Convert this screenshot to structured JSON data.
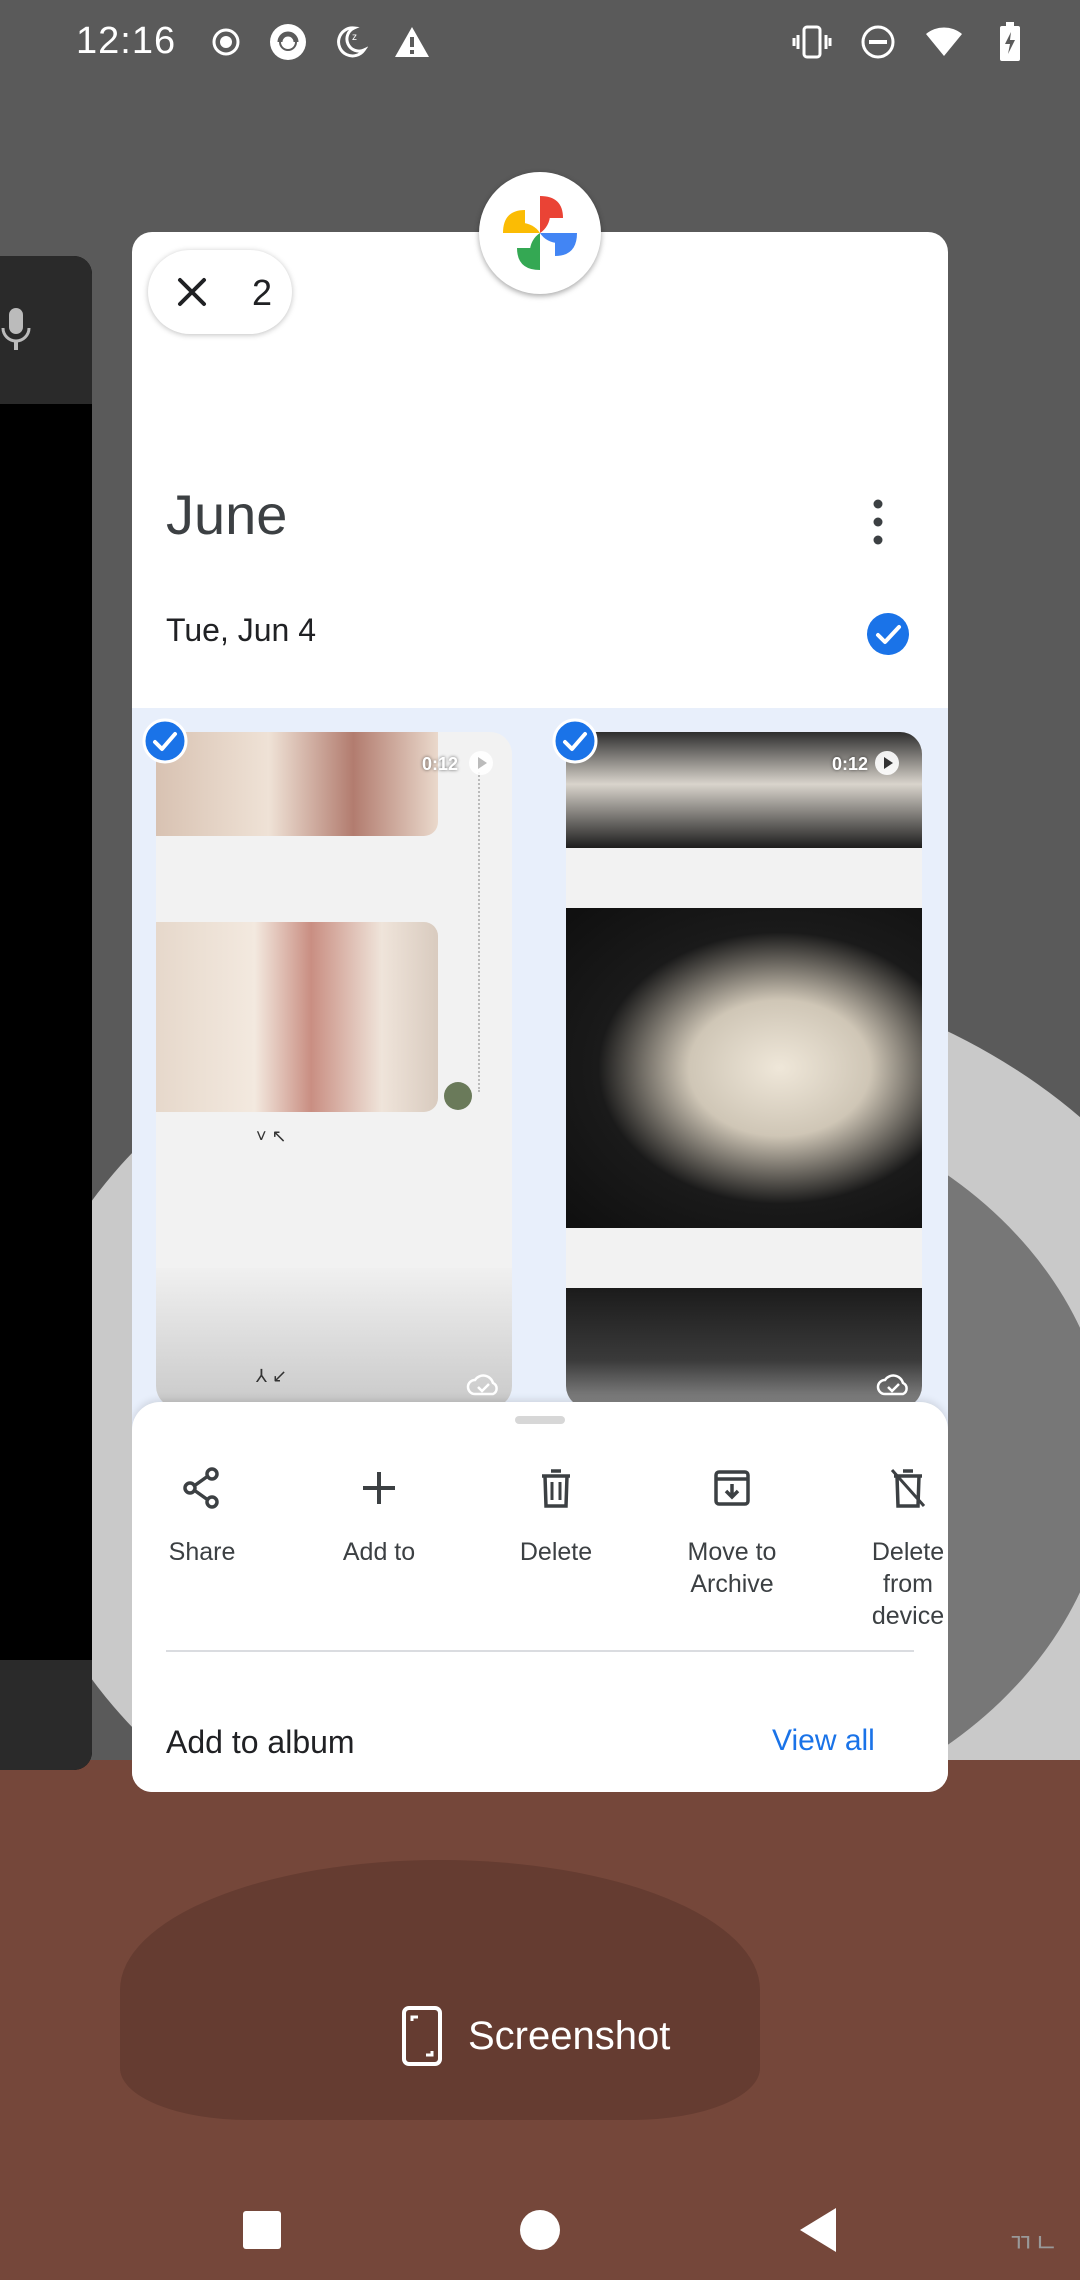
{
  "status_bar": {
    "time": "12:16",
    "left_icons": [
      "record-icon",
      "data-saver-icon",
      "night-mode-icon",
      "warning-icon"
    ],
    "right_icons": [
      "vibrate-icon",
      "do-not-disturb-icon",
      "wifi-icon",
      "battery-charging-icon"
    ]
  },
  "card": {
    "app": "photos-app-icon",
    "selection_count": "2",
    "month": "June",
    "date": "Tue, Jun 4",
    "accent": "#1a73e8",
    "tiles": [
      {
        "duration": "0:12",
        "selected": true
      },
      {
        "duration": "0:12",
        "selected": true
      }
    ],
    "tile_a_marks_top": "˅ ↖",
    "tile_a_marks_bottom": "⅄ ↙"
  },
  "sheet": {
    "actions": [
      {
        "label": "Share",
        "icon": "share-icon"
      },
      {
        "label": "Add to",
        "icon": "plus-icon"
      },
      {
        "label": "Delete",
        "icon": "trash-icon"
      },
      {
        "label": "Move to Archive",
        "icon": "archive-icon"
      },
      {
        "label": "Delete from device",
        "icon": "delete-device-icon"
      }
    ],
    "album_label": "Add to album",
    "view_all": "View all"
  },
  "screenshot_button": {
    "label": "Screenshot"
  },
  "wallpaper_corner_text": "ㄲㄴ",
  "nav": [
    "recents-button",
    "home-button",
    "back-button"
  ]
}
